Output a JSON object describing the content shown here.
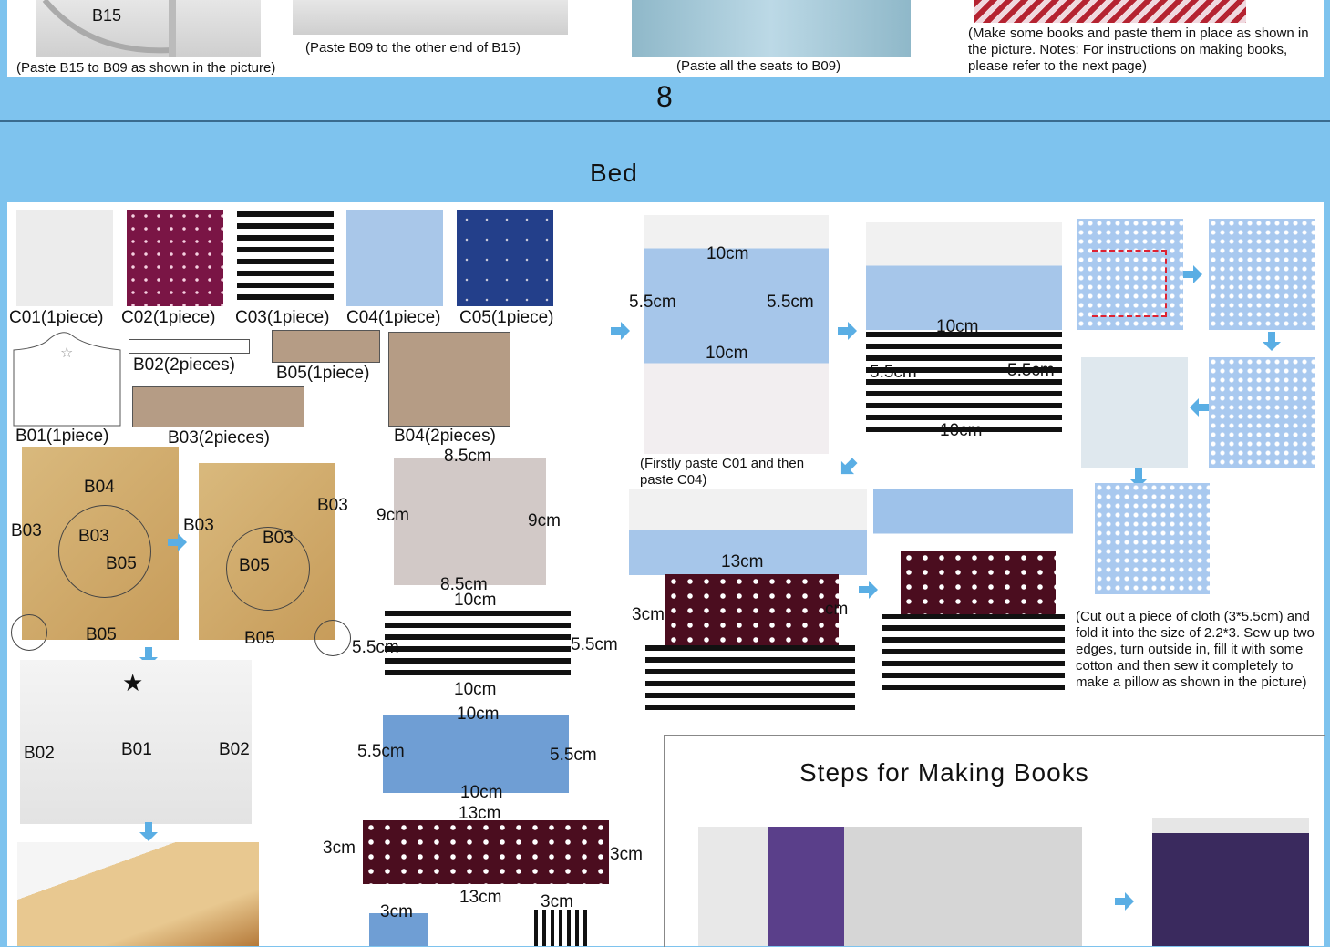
{
  "prev_step": {
    "captions": [
      "(Paste B15 to B09 as shown in the picture)",
      "(Paste B09 to the other end of B15)",
      "(Paste all the seats to B09)",
      "(Make some books and paste them in place as shown in the picture. Notes: For instructions on making books, please refer to the next page)"
    ],
    "b15_label": "B15"
  },
  "page_number": "8",
  "section_title": "Bed",
  "materials": [
    {
      "id": "C01",
      "label": "C01(1piece)"
    },
    {
      "id": "C02",
      "label": "C02(1piece)"
    },
    {
      "id": "C03",
      "label": "C03(1piece)"
    },
    {
      "id": "C04",
      "label": "C04(1piece)"
    },
    {
      "id": "C05",
      "label": "C05(1piece)"
    }
  ],
  "parts": {
    "b01": "B01(1piece)",
    "b02": "B02(2pieces)",
    "b03": "B03(2pieces)",
    "b04": "B04(2pieces)",
    "b05": "B05(1piece)"
  },
  "assembly_labels": {
    "b04": "B04",
    "b03": "B03",
    "b05": "B05",
    "b01": "B01",
    "b02": "B02"
  },
  "fabric_dims": {
    "felt": {
      "top": "8.5cm",
      "left": "9cm",
      "right": "9cm",
      "bottom": "8.5cm"
    },
    "stripe": {
      "top": "10cm",
      "left": "5.5cm",
      "right": "5.5cm",
      "bottom": "10cm"
    },
    "blue": {
      "top": "10cm",
      "left": "5.5cm",
      "right": "5.5cm",
      "bottom": "10cm"
    },
    "dots": {
      "top": "13cm",
      "left": "3cm",
      "right": "3cm",
      "bottom": "13cm"
    },
    "small1": {
      "top": "3cm"
    },
    "small2": {
      "top": "3cm"
    }
  },
  "bed_steps": {
    "step1": {
      "top": "10cm",
      "left": "5.5cm",
      "right": "5.5cm",
      "bottom": "10cm"
    },
    "step2": {
      "top": "10cm",
      "left": "5.5cm",
      "right": "5.5cm",
      "bottom": "10cm"
    },
    "step3": {
      "top": "13cm",
      "left": "3cm",
      "right": "cm"
    },
    "caption1": "(Firstly paste C01 and then paste C04)"
  },
  "pillow_caption": "(Cut out a piece of cloth (3*5.5cm) and fold it into the size of 2.2*3. Sew up two edges, turn outside in, fill it with some cotton and then sew it completely to make a pillow as shown in the picture)",
  "books_title": "Steps for Making Books",
  "colors": {
    "background": "#7ec3ee",
    "arrow": "#5aaee4",
    "panel": "#ffffff"
  }
}
